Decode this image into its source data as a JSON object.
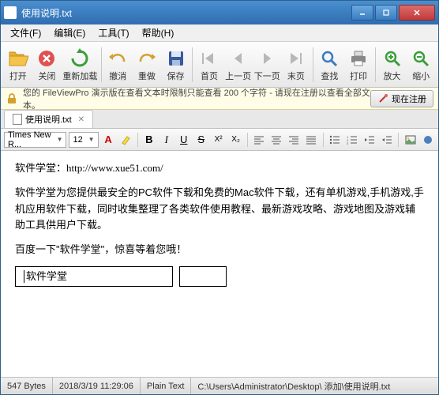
{
  "window": {
    "title": "使用说明.txt"
  },
  "menu": {
    "file": "文件(F)",
    "edit": "编辑(E)",
    "tools": "工具(T)",
    "help": "帮助(H)"
  },
  "toolbar": {
    "open": "打开",
    "close": "关闭",
    "reload": "重新加载",
    "undo": "撤消",
    "redo": "重做",
    "save": "保存",
    "first": "首页",
    "prev": "上一页",
    "next": "下一页",
    "last": "末页",
    "find": "查找",
    "print": "打印",
    "zoomin": "放大",
    "zoomout": "缩小"
  },
  "banner": {
    "message": "您的 FileViewPro 演示版在查看文本时限制只能查看 200 个字符 - 请现在注册以查看全部文本。",
    "register": "现在注册"
  },
  "tab": {
    "label": "使用说明.txt"
  },
  "format": {
    "font": "Times New R...",
    "size": "12"
  },
  "doc": {
    "line1_label": "软件学堂：",
    "line1_url": "http://www.xue51.com/",
    "para1": "软件学堂为您提供最安全的PC软件下载和免费的Mac软件下载，还有单机游戏,手机游戏,手机应用软件下载，同时收集整理了各类软件使用教程、最新游戏攻略、游戏地图及游戏辅助工具供用户下载。",
    "para2": "百度一下\"软件学堂\"，惊喜等着您哦！",
    "boxtext": "软件学堂"
  },
  "status": {
    "size": "547 Bytes",
    "datetime": "2018/3/19 11:29:06",
    "type": "Plain Text",
    "path": "C:\\Users\\Administrator\\Desktop\\   添加\\使用说明.txt"
  }
}
